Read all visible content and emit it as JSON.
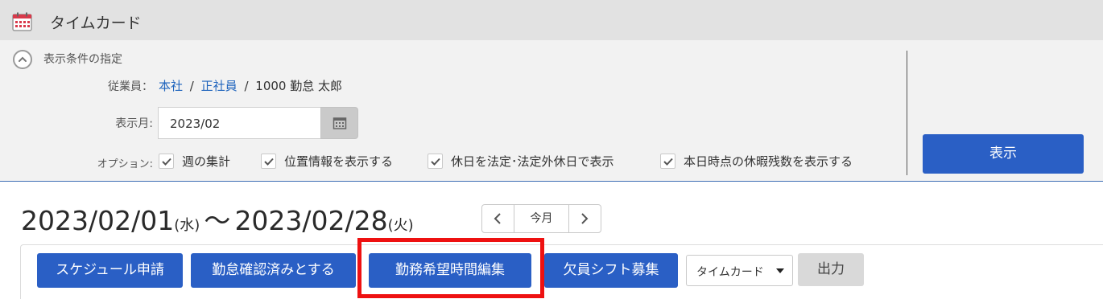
{
  "header": {
    "title": "タイムカード",
    "icon": "calendar-icon"
  },
  "filter": {
    "title": "表示条件の指定",
    "employee_label": "従業員：",
    "employee_path": [
      "本社",
      "正社員"
    ],
    "separator": "/",
    "employee_name": "1000 勤怠 太郎",
    "month_label": "表示月:",
    "month_value": "2023/02",
    "options_label": "オプション:",
    "options": [
      {
        "label": "週の集計",
        "checked": true
      },
      {
        "label": "位置情報を表示する",
        "checked": true
      },
      {
        "label": "休日を法定･法定外休日で表示",
        "checked": true
      },
      {
        "label": "本日時点の休暇残数を表示する",
        "checked": true
      }
    ],
    "show_button": "表示"
  },
  "range": {
    "start": "2023/02/01",
    "start_dow": "(水)",
    "tilde": "〜",
    "end": "2023/02/28",
    "end_dow": "(火)"
  },
  "pager": {
    "today_label": "今月"
  },
  "toolbar": {
    "buttons": [
      "スケジュール申請",
      "勤怠確認済みとする",
      "勤務希望時間編集",
      "欠員シフト募集"
    ],
    "highlighted_button": "勤務希望時間編集",
    "select_value": "タイムカード",
    "output_button": "出力"
  },
  "colors": {
    "primary": "#2a5fc5",
    "link": "#1f64bd",
    "highlight": "#ee1111",
    "header_bg": "#e2e2e2",
    "panel_bg": "#f2f2f2"
  }
}
